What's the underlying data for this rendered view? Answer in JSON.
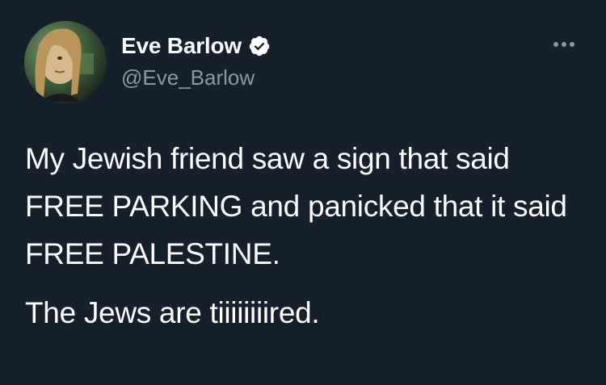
{
  "author": {
    "display_name": "Eve Barlow",
    "handle": "@Eve_Barlow",
    "verified": true
  },
  "tweet": {
    "paragraphs": [
      "My Jewish friend saw a sign that said FREE PARKING and panicked that it said FREE PALESTINE.",
      "The Jews are tiiiiiiiired."
    ]
  },
  "colors": {
    "background": "#15202b",
    "primary_text": "#ffffff",
    "secondary_text": "#8899a6",
    "verified_badge": "#ffffff"
  },
  "icons": {
    "verified": "verified-badge-icon",
    "more": "more-options-icon"
  }
}
